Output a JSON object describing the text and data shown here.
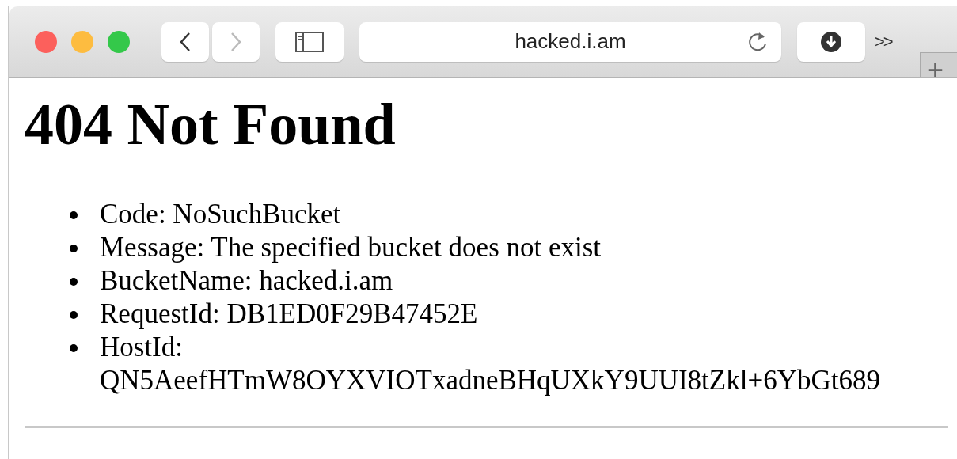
{
  "toolbar": {
    "address": "hacked.i.am",
    "overflow": ">>",
    "new_tab": "+"
  },
  "page": {
    "heading": "404 Not Found",
    "items": [
      {
        "text": "Code: NoSuchBucket"
      },
      {
        "text": "Message: The specified bucket does not exist"
      },
      {
        "text": "BucketName: hacked.i.am"
      },
      {
        "text": "RequestId: DB1ED0F29B47452E"
      },
      {
        "text": "HostId: QN5AeefHTmW8OYXVIOTxadneBHqUXkY9UUI8tZkl+6YbGt689"
      }
    ]
  }
}
